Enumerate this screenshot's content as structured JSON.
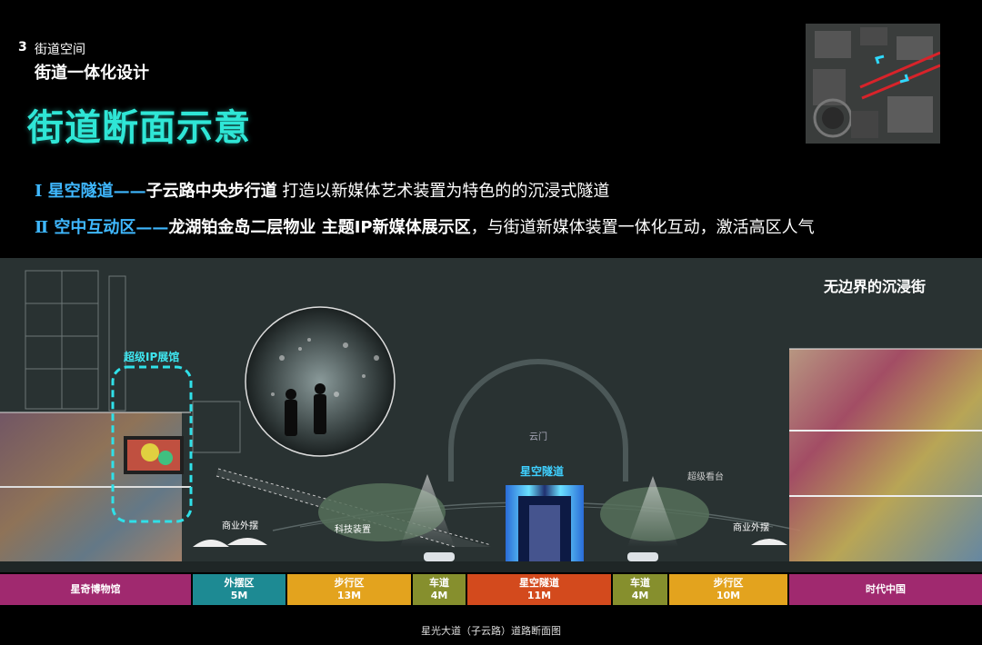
{
  "header": {
    "section_number": "3",
    "section_title": "街道空间",
    "subtitle": "街道一体化设计",
    "title": "街道断面示意"
  },
  "descriptions": [
    {
      "prefix": "Ⅰ 星空隧道——",
      "bold": "子云路中央步行道",
      "rest": " 打造以新媒体艺术装置为特色的的沉浸式隧道"
    },
    {
      "prefix": "Ⅱ 空中互动区——",
      "bold": "龙湖铂金岛二层物业 主题IP新媒体展示区",
      "rest": "，与街道新媒体装置一体化互动，激活高区人气"
    }
  ],
  "diagram": {
    "corner_title": "无边界的沉浸街",
    "label_ip_hall": "超级IP展馆",
    "label_cloud_gate": "云门",
    "label_tunnel": "星空隧道",
    "label_stand": "超级看台",
    "label_tech": "科技装置",
    "label_commerce_left": "商业外摆",
    "label_commerce_right": "商业外摆"
  },
  "zones": [
    {
      "name": "星奇博物馆",
      "width": "",
      "color": "#a0296f"
    },
    {
      "name": "外摆区",
      "width": "5M",
      "color": "#1d8a93"
    },
    {
      "name": "步行区",
      "width": "13M",
      "color": "#e3a31e"
    },
    {
      "name": "车道",
      "width": "4M",
      "color": "#868f2d"
    },
    {
      "name": "星空隧道",
      "width": "11M",
      "color": "#d34a1d"
    },
    {
      "name": "车道",
      "width": "4M",
      "color": "#868f2d"
    },
    {
      "name": "步行区",
      "width": "10M",
      "color": "#e3a31e"
    },
    {
      "name": "时代中国",
      "width": "",
      "color": "#a0296f"
    }
  ],
  "caption": "星光大道（子云路）道路断面图"
}
